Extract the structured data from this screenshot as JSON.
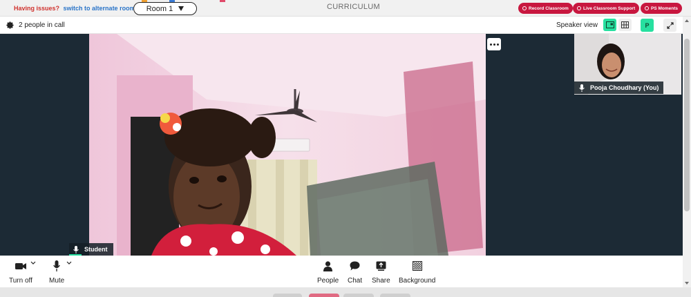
{
  "topbar": {
    "issues_text": "Having issues?",
    "alternate_link": "switch to alternate room",
    "room_select": "Room 1",
    "title": "CURRICULUM",
    "buttons": {
      "record": "Record Classroom",
      "support": "Live Classroom Support",
      "moments": "PS Moments"
    },
    "accent_color": "#c8173f"
  },
  "call_header": {
    "people_count": "2 people in call",
    "view_mode": "Speaker view",
    "participant_initial": "P",
    "active_color": "#27e0a0"
  },
  "main_video": {
    "participant_name": "Student",
    "mic_icon": "mic-icon",
    "more_icon": "more-dots-icon"
  },
  "thumbnail": {
    "participant_name": "Pooja Choudhary (You)"
  },
  "controls": {
    "turn_off": "Turn off",
    "mute": "Mute",
    "people": "People",
    "chat": "Chat",
    "share": "Share",
    "background": "Background"
  }
}
